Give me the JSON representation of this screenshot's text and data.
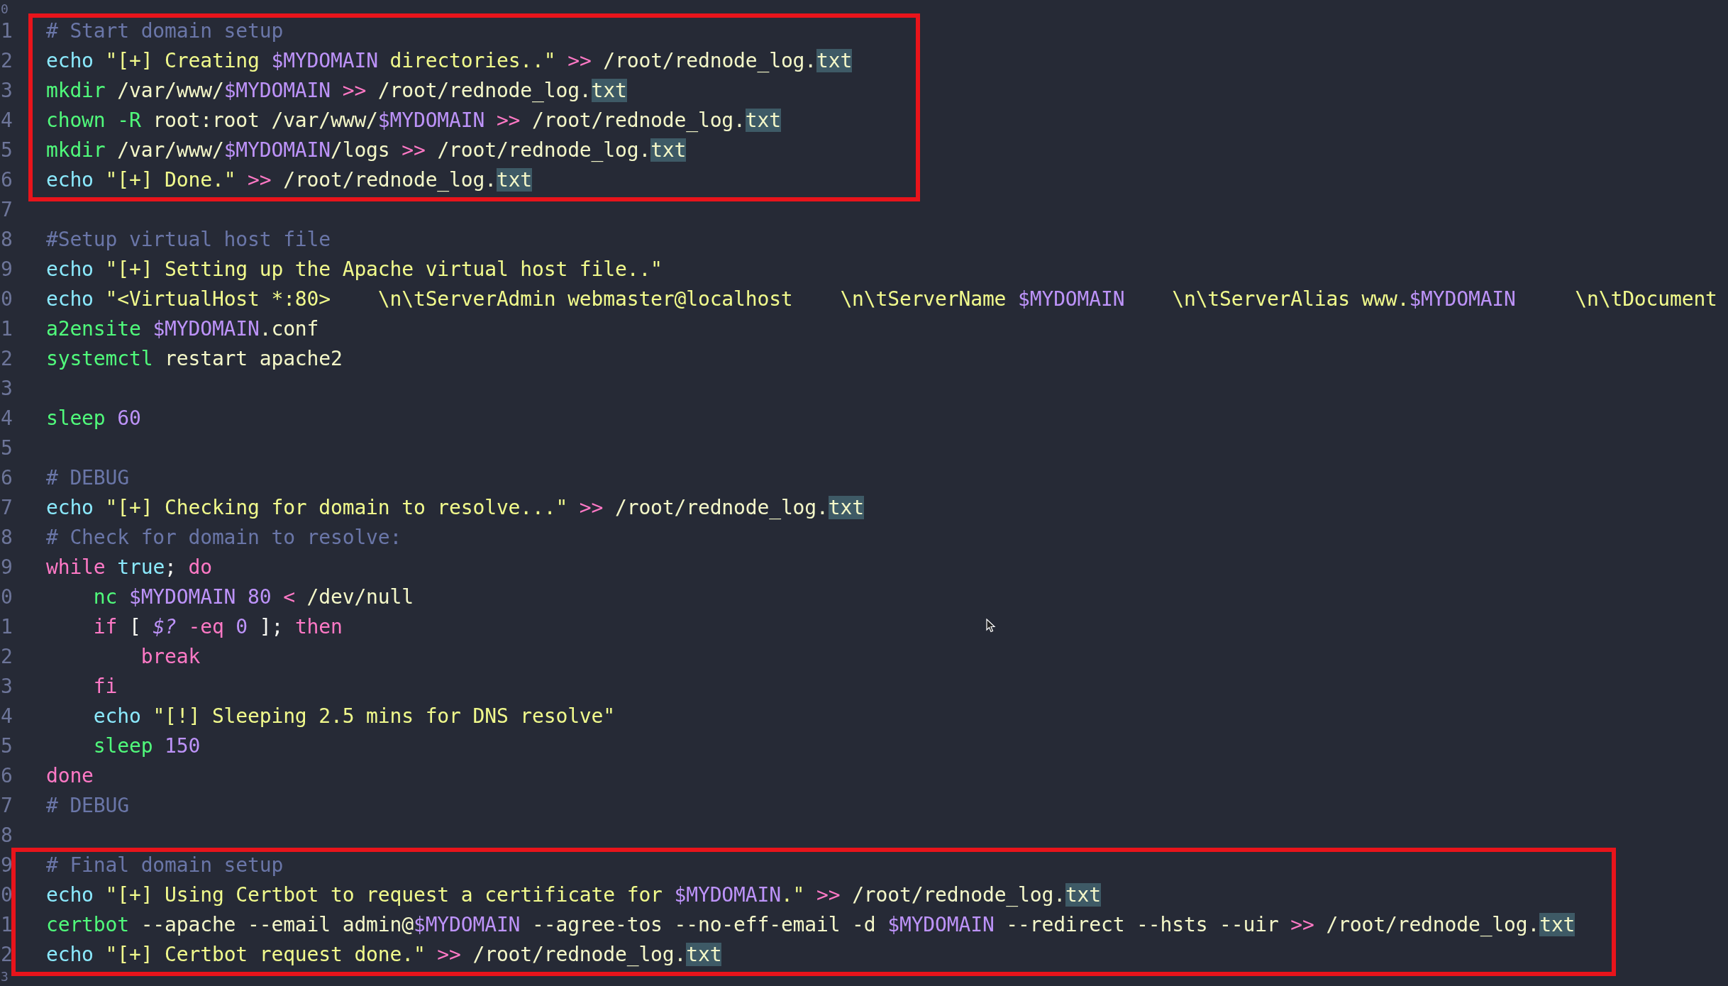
{
  "editor": {
    "blocks": [
      {
        "boxed": false,
        "lines": [
          {
            "number": "0"
          }
        ]
      },
      {
        "boxed": true,
        "lines": [
          {
            "number": "1",
            "tokens": [
              {
                "kind": "comment",
                "text": "# Start domain setup"
              }
            ]
          },
          {
            "number": "2",
            "tokens": [
              {
                "kind": "builtin",
                "text": "echo"
              },
              {
                "kind": "str",
                "text": " \"[+] Creating "
              },
              {
                "kind": "var",
                "text": "$MYDOMAIN"
              },
              {
                "kind": "str",
                "text": " directories..\" "
              },
              {
                "kind": "op",
                "text": ">>"
              },
              {
                "kind": "arg",
                "text": " /root/rednode_log."
              },
              {
                "kind": "match",
                "text": "txt"
              }
            ]
          },
          {
            "number": "3",
            "tokens": [
              {
                "kind": "cmd",
                "text": "mkdir"
              },
              {
                "kind": "arg",
                "text": " /var/www/"
              },
              {
                "kind": "var",
                "text": "$MYDOMAIN"
              },
              {
                "kind": "op",
                "text": " >>"
              },
              {
                "kind": "arg",
                "text": " /root/rednode_log."
              },
              {
                "kind": "match",
                "text": "txt"
              }
            ]
          },
          {
            "number": "4",
            "tokens": [
              {
                "kind": "cmd",
                "text": "chown -R"
              },
              {
                "kind": "arg",
                "text": " root:root /var/www/"
              },
              {
                "kind": "var",
                "text": "$MYDOMAIN"
              },
              {
                "kind": "op",
                "text": " >>"
              },
              {
                "kind": "arg",
                "text": " /root/rednode_log."
              },
              {
                "kind": "match",
                "text": "txt"
              }
            ]
          },
          {
            "number": "5",
            "tokens": [
              {
                "kind": "cmd",
                "text": "mkdir"
              },
              {
                "kind": "arg",
                "text": " /var/www/"
              },
              {
                "kind": "var",
                "text": "$MYDOMAIN"
              },
              {
                "kind": "arg",
                "text": "/logs"
              },
              {
                "kind": "op",
                "text": " >>"
              },
              {
                "kind": "arg",
                "text": " /root/rednode_log."
              },
              {
                "kind": "match",
                "text": "txt"
              }
            ]
          },
          {
            "number": "6",
            "tokens": [
              {
                "kind": "builtin",
                "text": "echo"
              },
              {
                "kind": "str",
                "text": " \"[+] Done.\" "
              },
              {
                "kind": "op",
                "text": ">>"
              },
              {
                "kind": "arg",
                "text": " /root/rednode_log."
              },
              {
                "kind": "match",
                "text": "txt"
              }
            ]
          }
        ]
      },
      {
        "boxed": false,
        "lines": [
          {
            "number": "7"
          },
          {
            "number": "8",
            "tokens": [
              {
                "kind": "comment",
                "text": "#Setup virtual host file"
              }
            ]
          },
          {
            "number": "9",
            "tokens": [
              {
                "kind": "builtin",
                "text": "echo"
              },
              {
                "kind": "str",
                "text": " \"[+] Setting up the Apache virtual host file..\""
              }
            ]
          },
          {
            "number": "0",
            "tokens": [
              {
                "kind": "builtin",
                "text": "echo"
              },
              {
                "kind": "str",
                "text": " \"<VirtualHost *:80>    \\n\\tServerAdmin webmaster@localhost    \\n\\tServerName "
              },
              {
                "kind": "var",
                "text": "$MYDOMAIN"
              },
              {
                "kind": "str",
                "text": "    \\n\\tServerAlias www."
              },
              {
                "kind": "var",
                "text": "$MYDOMAIN"
              },
              {
                "kind": "str",
                "text": "     \\n\\tDocument"
              }
            ]
          },
          {
            "number": "1",
            "tokens": [
              {
                "kind": "cmd",
                "text": "a2ensite"
              },
              {
                "kind": "var",
                "text": " $MYDOMAIN"
              },
              {
                "kind": "arg",
                "text": ".conf"
              }
            ]
          },
          {
            "number": "2",
            "tokens": [
              {
                "kind": "cmd",
                "text": "systemctl"
              },
              {
                "kind": "arg",
                "text": " restart apache2"
              }
            ]
          },
          {
            "number": "3"
          },
          {
            "number": "4",
            "tokens": [
              {
                "kind": "cmd",
                "text": "sleep"
              },
              {
                "kind": "num",
                "text": " 60"
              }
            ]
          },
          {
            "number": "5"
          },
          {
            "number": "6",
            "tokens": [
              {
                "kind": "comment",
                "text": "# DEBUG"
              }
            ]
          },
          {
            "number": "7",
            "tokens": [
              {
                "kind": "builtin",
                "text": "echo"
              },
              {
                "kind": "str",
                "text": " \"[+] Checking for domain to resolve...\" "
              },
              {
                "kind": "op",
                "text": ">>"
              },
              {
                "kind": "arg",
                "text": " /root/rednode_log."
              },
              {
                "kind": "match",
                "text": "txt"
              }
            ]
          },
          {
            "number": "8",
            "tokens": [
              {
                "kind": "comment",
                "text": "# Check for domain to resolve:"
              }
            ]
          },
          {
            "number": "9",
            "tokens": [
              {
                "kind": "kw",
                "text": "while"
              },
              {
                "kind": "builtin",
                "text": " true"
              },
              {
                "kind": "punct",
                "text": "; "
              },
              {
                "kind": "kw",
                "text": "do"
              }
            ]
          },
          {
            "number": "0",
            "tokens": [
              {
                "kind": "cmd",
                "text": "    nc"
              },
              {
                "kind": "var",
                "text": " $MYDOMAIN"
              },
              {
                "kind": "num",
                "text": " 80"
              },
              {
                "kind": "op",
                "text": " <"
              },
              {
                "kind": "arg",
                "text": " /dev/null"
              }
            ]
          },
          {
            "number": "1",
            "tokens": [
              {
                "kind": "kw",
                "text": "    if"
              },
              {
                "kind": "punct",
                "text": " [ "
              },
              {
                "kind": "ivar",
                "text": "$?"
              },
              {
                "kind": "op",
                "text": " -eq"
              },
              {
                "kind": "num",
                "text": " 0"
              },
              {
                "kind": "punct",
                "text": " ]; "
              },
              {
                "kind": "kw",
                "text": "then"
              }
            ]
          },
          {
            "number": "2",
            "tokens": [
              {
                "kind": "kw",
                "text": "        break"
              }
            ]
          },
          {
            "number": "3",
            "tokens": [
              {
                "kind": "kw",
                "text": "    fi"
              }
            ]
          },
          {
            "number": "4",
            "tokens": [
              {
                "kind": "builtin",
                "text": "    echo"
              },
              {
                "kind": "str",
                "text": " \"[!] Sleeping 2.5 mins for DNS resolve\""
              }
            ]
          },
          {
            "number": "5",
            "tokens": [
              {
                "kind": "cmd",
                "text": "    sleep"
              },
              {
                "kind": "num",
                "text": " 150"
              }
            ]
          },
          {
            "number": "6",
            "tokens": [
              {
                "kind": "kw",
                "text": "done"
              }
            ]
          },
          {
            "number": "7",
            "tokens": [
              {
                "kind": "comment",
                "text": "# DEBUG"
              }
            ]
          },
          {
            "number": "8"
          }
        ]
      },
      {
        "boxed": true,
        "lines": [
          {
            "number": "9",
            "tokens": [
              {
                "kind": "comment",
                "text": "# Final domain setup"
              }
            ]
          },
          {
            "number": "0",
            "tokens": [
              {
                "kind": "builtin",
                "text": "echo"
              },
              {
                "kind": "str",
                "text": " \"[+] Using Certbot to request a certificate for "
              },
              {
                "kind": "var",
                "text": "$MYDOMAIN"
              },
              {
                "kind": "str",
                "text": ".\" "
              },
              {
                "kind": "op",
                "text": ">>"
              },
              {
                "kind": "arg",
                "text": " /root/rednode_log."
              },
              {
                "kind": "match",
                "text": "txt"
              }
            ]
          },
          {
            "number": "1",
            "tokens": [
              {
                "kind": "cmd",
                "text": "certbot"
              },
              {
                "kind": "arg",
                "text": " --apache --email admin@"
              },
              {
                "kind": "var",
                "text": "$MYDOMAIN"
              },
              {
                "kind": "arg",
                "text": " --agree-tos --no-eff-email -d "
              },
              {
                "kind": "var",
                "text": "$MYDOMAIN"
              },
              {
                "kind": "arg",
                "text": " --redirect --hsts --uir "
              },
              {
                "kind": "op",
                "text": ">>"
              },
              {
                "kind": "arg",
                "text": " /root/rednode_log."
              },
              {
                "kind": "match",
                "text": "txt"
              }
            ]
          },
          {
            "number": "2",
            "tokens": [
              {
                "kind": "builtin",
                "text": "echo"
              },
              {
                "kind": "str",
                "text": " \"[+] Certbot request done.\" "
              },
              {
                "kind": "op",
                "text": ">>"
              },
              {
                "kind": "arg",
                "text": " /root/rednode_log."
              },
              {
                "kind": "match",
                "text": "txt"
              }
            ]
          }
        ]
      },
      {
        "boxed": false,
        "lines": [
          {
            "number": "3"
          }
        ]
      }
    ]
  }
}
